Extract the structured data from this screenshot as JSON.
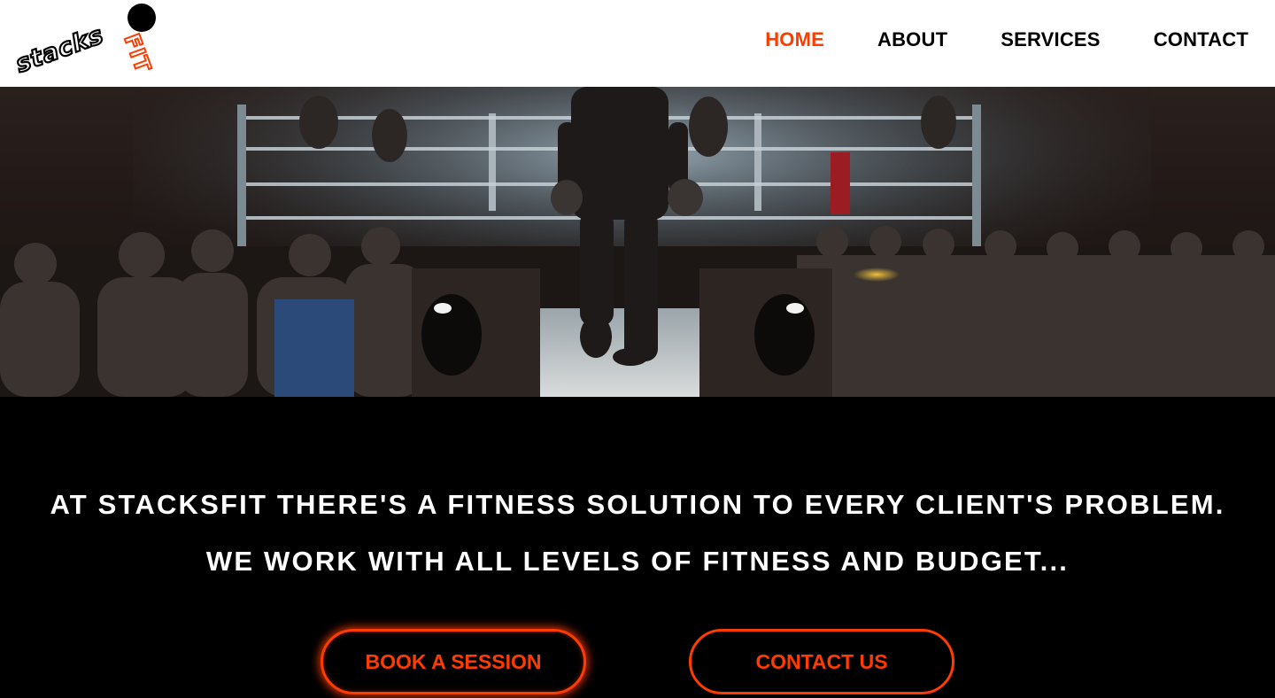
{
  "header": {
    "logo": {
      "text_main": "STACKS",
      "text_accent": "FIT",
      "icon": "ball-icon"
    },
    "nav": [
      {
        "label": "HOME",
        "active": true
      },
      {
        "label": "ABOUT",
        "active": false
      },
      {
        "label": "SERVICES",
        "active": false
      },
      {
        "label": "CONTACT",
        "active": false
      }
    ]
  },
  "hero": {
    "image": "boxer-walking-to-ring-photo"
  },
  "main": {
    "tagline_line1": "AT STACKSFIT THERE'S A FITNESS SOLUTION TO EVERY CLIENT'S PROBLEM.",
    "tagline_line2": "WE WORK WITH ALL LEVELS OF FITNESS AND BUDGET...",
    "book_button": "BOOK A SESSION",
    "contact_button": "CONTACT US"
  },
  "colors": {
    "accent": "#ff3c00",
    "header_bg": "#ffffff",
    "body_bg": "#000000",
    "text_light": "#ffffff"
  }
}
